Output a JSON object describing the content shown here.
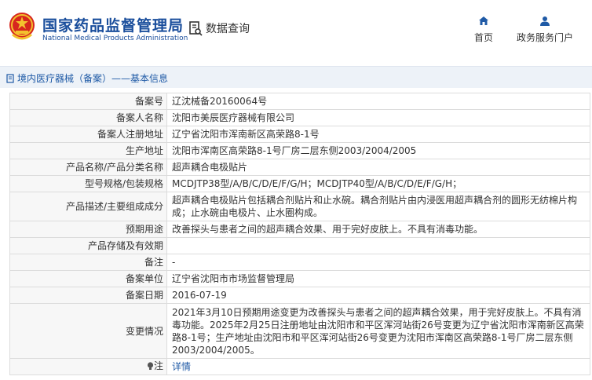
{
  "header": {
    "brand_cn": "国家药品监督管理局",
    "brand_en": "National Medical Products Administration",
    "query_label": "数据查询",
    "nav": {
      "home": "首页",
      "portal": "政务服务门户"
    },
    "colors": {
      "brand": "#1a4e9c",
      "emblem_red": "#d7261e",
      "emblem_gold": "#f3c12e"
    }
  },
  "breadcrumb": {
    "text": "境内医疗器械（备案）——基本信息"
  },
  "record": {
    "rows": [
      {
        "key": "备案号",
        "value": "辽沈械备20160064号"
      },
      {
        "key": "备案人名称",
        "value": "沈阳市美辰医疗器械有限公司"
      },
      {
        "key": "备案人注册地址",
        "value": "辽宁省沈阳市浑南新区高荣路8-1号"
      },
      {
        "key": "生产地址",
        "value": "沈阳市浑南区高荣路8-1号厂房二层东侧2003/2004/2005"
      },
      {
        "key": "产品名称/产品分类名称",
        "value": "超声耦合电极贴片"
      },
      {
        "key": "型号规格/包装规格",
        "value": "MCDJTP38型/A/B/C/D/E/F/G/H；MCDJTP40型/A/B/C/D/E/F/G/H；"
      },
      {
        "key": "产品描述/主要组成成分",
        "value": "超声耦合电极贴片包括耦合剂贴片和止水碗。耦合剂贴片由内浸医用超声耦合剂的圆形无纺棉片构成；止水碗由电极片、止水圈构成。"
      },
      {
        "key": "预期用途",
        "value": "改善探头与患者之间的超声耦合效果、用于完好皮肤上。不具有消毒功能。"
      },
      {
        "key": "产品存储及有效期",
        "value": ""
      },
      {
        "key": "备注",
        "value": "-"
      },
      {
        "key": "备案单位",
        "value": "辽宁省沈阳市市场监督管理局"
      },
      {
        "key": "备案日期",
        "value": "2016-07-19"
      },
      {
        "key": "变更情况",
        "value": "2021年3月10日预期用途变更为改善探头与患者之间的超声耦合效果，用于完好皮肤上。不具有消毒功能。2025年2月25日注册地址由沈阳市和平区浑河站街26号变更为辽宁省沈阳市浑南新区高荣路8-1号；生产地址由沈阳市和平区浑河站街26号变更为沈阳市浑南区高荣路8-1号厂房二层东侧2003/2004/2005。"
      },
      {
        "key": "注",
        "value": "详情",
        "icon": "bulb-icon"
      }
    ]
  }
}
